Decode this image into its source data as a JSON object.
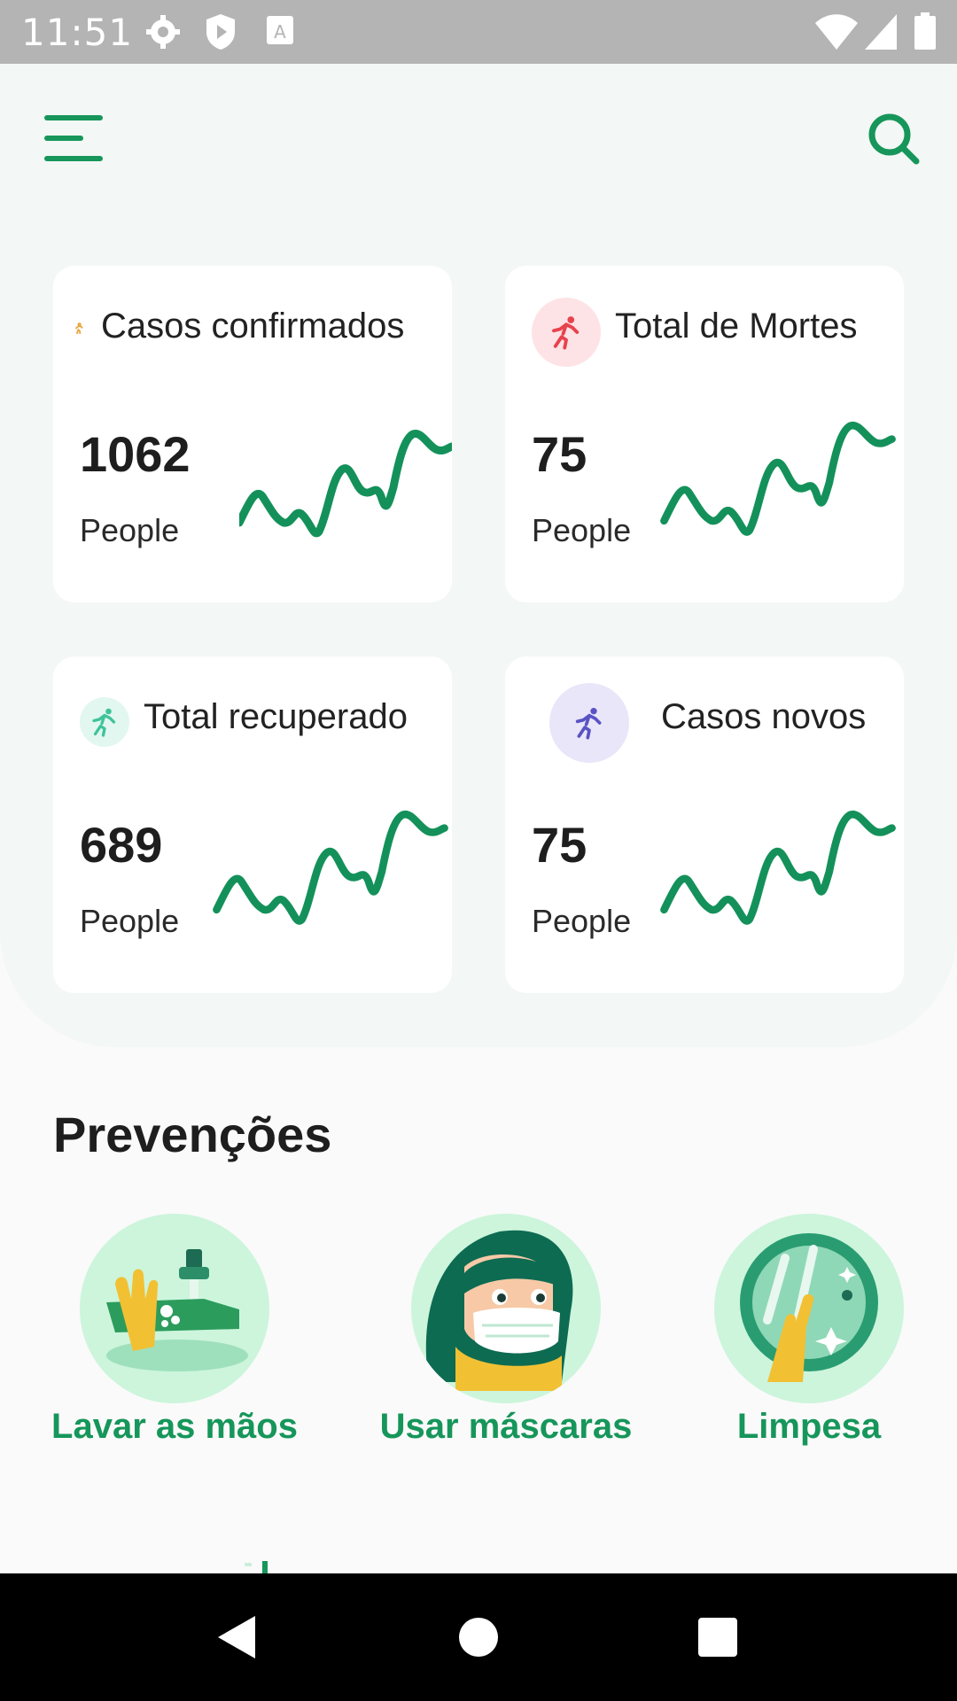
{
  "status_bar": {
    "time": "11:51",
    "icons": [
      "gear-icon",
      "shield-play-icon",
      "text-a-icon",
      "wifi-icon",
      "signal-icon",
      "battery-icon"
    ]
  },
  "header": {
    "menu_icon": "menu-icon",
    "search_icon": "search-icon"
  },
  "stats": [
    {
      "title": "Casos confirmados",
      "value": "1062",
      "unit": "People",
      "icon": "running-person-icon",
      "icon_color": "#e8a33a",
      "icon_bg": "#ffffff"
    },
    {
      "title": "Total de Mortes",
      "value": "75",
      "unit": "People",
      "icon": "running-person-icon",
      "icon_color": "#e8434d",
      "icon_bg": "#fde3e6"
    },
    {
      "title": "Total recuperado",
      "value": "689",
      "unit": "People",
      "icon": "running-person-icon",
      "icon_color": "#3fc39a",
      "icon_bg": "#e2f7ef"
    },
    {
      "title": "Casos novos",
      "value": "75",
      "unit": "People",
      "icon": "running-person-icon",
      "icon_color": "#5a52c4",
      "icon_bg": "#e8e6f8"
    }
  ],
  "colors": {
    "accent": "#16965a",
    "sparkline": "#14915a"
  },
  "prevention": {
    "title": "Prevenções",
    "items": [
      {
        "label": "Lavar as mãos",
        "icon": "hand-washing-illustration"
      },
      {
        "label": "Usar máscaras",
        "icon": "face-mask-illustration"
      },
      {
        "label": "Limpesa",
        "icon": "cleaning-illustration"
      }
    ]
  }
}
